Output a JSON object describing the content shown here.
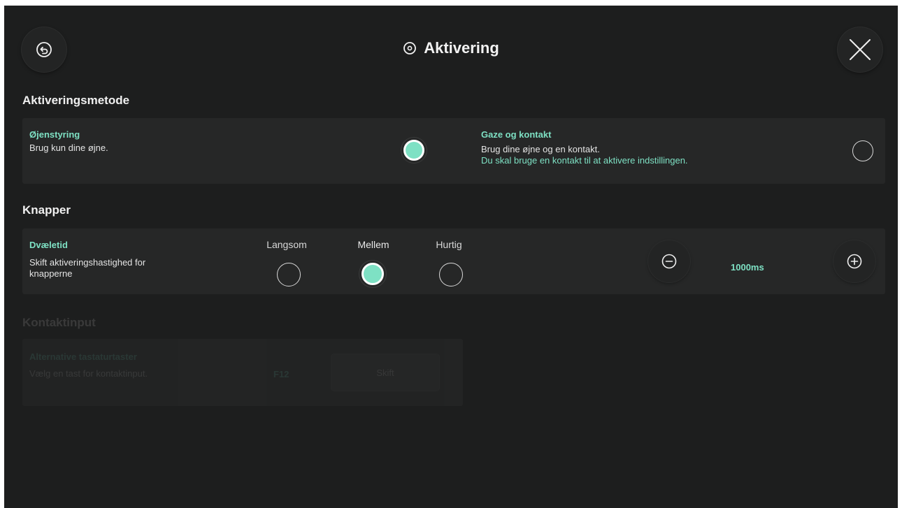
{
  "header": {
    "title": "Aktivering",
    "back_icon": "back-icon",
    "close_icon": "close-icon"
  },
  "activation": {
    "heading": "Aktiveringsmetode",
    "eye": {
      "label": "Øjenstyring",
      "desc": "Brug kun dine øjne.",
      "selected": true
    },
    "gaze": {
      "label": "Gaze og kontakt",
      "desc": "Brug dine øjne og en kontakt.",
      "note": "Du skal bruge en kontakt til at aktivere indstillingen.",
      "selected": false
    }
  },
  "buttons": {
    "heading": "Knapper",
    "dwell": {
      "label": "Dvæletid",
      "desc_line1": "Skift aktiveringshastighed for",
      "desc_line2": "knapperne",
      "options": [
        "Langsom",
        "Mellem",
        "Hurtig"
      ],
      "selected": "Mellem",
      "value": "1000ms"
    }
  },
  "contact": {
    "heading": "Kontaktinput",
    "alt_keys": {
      "label": "Alternative tastaturtaster",
      "desc": "Vælg en tast for kontaktinput.",
      "key": "F12",
      "button_label": "Skift"
    }
  },
  "colors": {
    "accent": "#7ee1c4",
    "background": "#1d1e1e",
    "card": "#262727"
  }
}
